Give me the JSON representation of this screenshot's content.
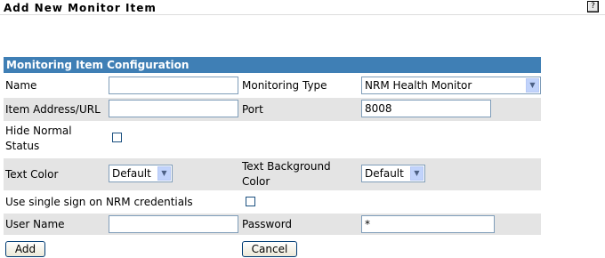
{
  "page": {
    "title": "Add New Monitor Item",
    "help_glyph": "?"
  },
  "section": {
    "title": "Monitoring Item Configuration"
  },
  "fields": {
    "name": {
      "label": "Name",
      "value": ""
    },
    "monitoring_type": {
      "label": "Monitoring Type",
      "value": "NRM Health Monitor"
    },
    "item_address": {
      "label": "Item Address/URL",
      "value": ""
    },
    "port": {
      "label": "Port",
      "value": "8008"
    },
    "hide_normal_status": {
      "label_line1": "Hide Normal",
      "label_line2": "Status",
      "checked": false
    },
    "text_color": {
      "label": "Text Color",
      "value": "Default"
    },
    "text_bg_color": {
      "label_line1": "Text Background",
      "label_line2": "Color",
      "value": "Default"
    },
    "single_sign_on": {
      "label": "Use single sign on NRM credentials",
      "checked": false
    },
    "user_name": {
      "label": "User Name",
      "value": ""
    },
    "password": {
      "label": "Password",
      "value": "*"
    }
  },
  "buttons": {
    "add": "Add",
    "cancel": "Cancel"
  },
  "icons": {
    "dropdown": "chevron-down-icon"
  }
}
